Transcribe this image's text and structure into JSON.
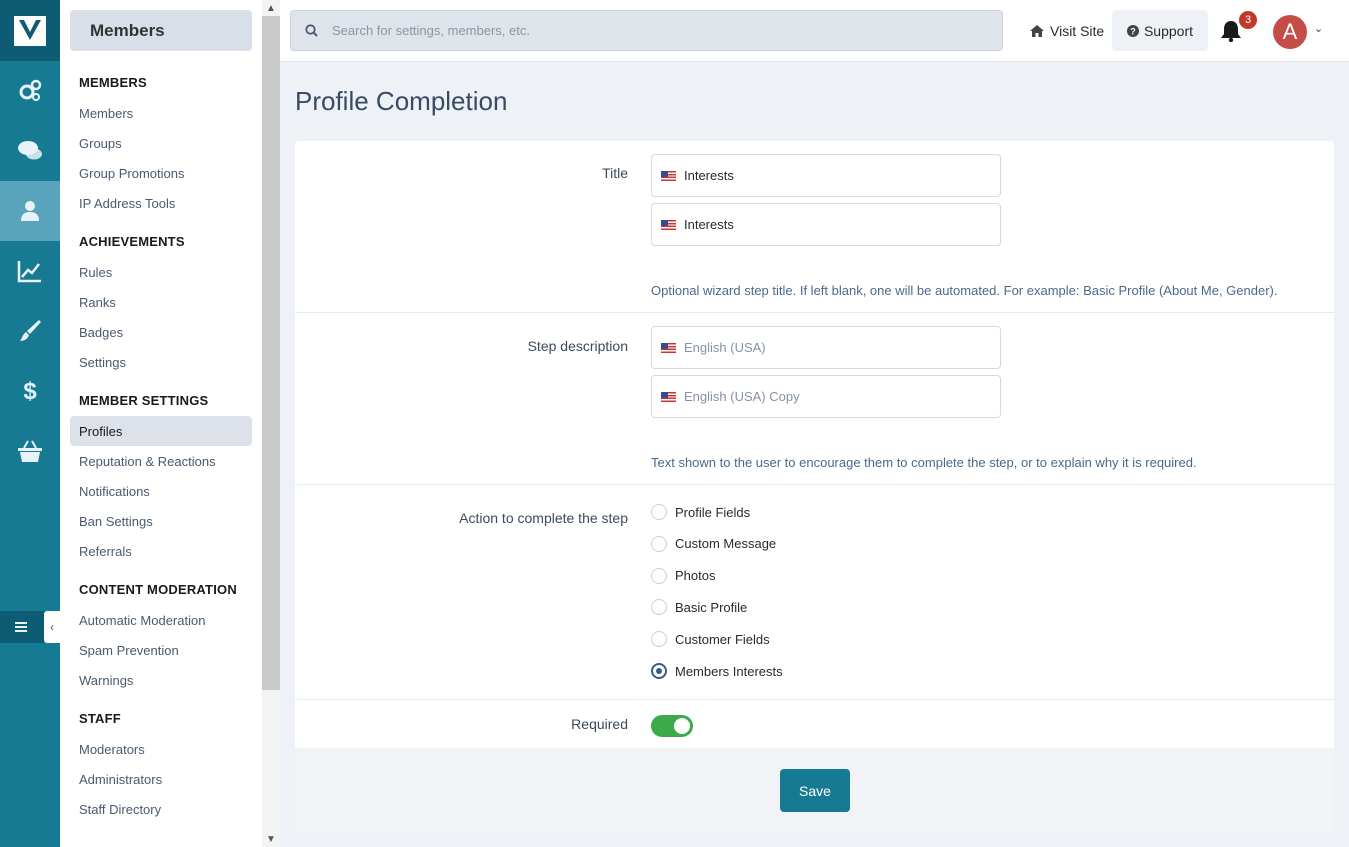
{
  "colors": {
    "rail": "#177a93",
    "accent": "#177a93",
    "toggle_on": "#3daa4a",
    "badge": "#c0392b",
    "avatar": "#c44e47"
  },
  "rail": {
    "icons": [
      "logo-icon",
      "gears-icon",
      "chat-icon",
      "user-icon",
      "chart-icon",
      "brush-icon",
      "dollar-icon",
      "basket-icon",
      "menu-icon",
      "chevron-left-icon"
    ],
    "active": "user-icon"
  },
  "sidebar": {
    "title": "Members",
    "sections": [
      {
        "heading": "MEMBERS",
        "items": [
          "Members",
          "Groups",
          "Group Promotions",
          "IP Address Tools"
        ]
      },
      {
        "heading": "ACHIEVEMENTS",
        "items": [
          "Rules",
          "Ranks",
          "Badges",
          "Settings"
        ]
      },
      {
        "heading": "MEMBER SETTINGS",
        "items": [
          "Profiles",
          "Reputation & Reactions",
          "Notifications",
          "Ban Settings",
          "Referrals"
        ]
      },
      {
        "heading": "CONTENT MODERATION",
        "items": [
          "Automatic Moderation",
          "Spam Prevention",
          "Warnings"
        ]
      },
      {
        "heading": "STAFF",
        "items": [
          "Moderators",
          "Administrators",
          "Staff Directory"
        ]
      }
    ],
    "active_item": "Profiles"
  },
  "topbar": {
    "search_placeholder": "Search for settings, members, etc.",
    "visit_site": "Visit Site",
    "support": "Support",
    "notification_count": "3",
    "avatar_letter": "A"
  },
  "page": {
    "title": "Profile Completion"
  },
  "form": {
    "title": {
      "label": "Title",
      "values": [
        "Interests",
        "Interests"
      ],
      "help": "Optional wizard step title. If left blank, one will be automated. For example: Basic Profile (About Me, Gender)."
    },
    "description": {
      "label": "Step description",
      "placeholders": [
        "English (USA)",
        "English (USA) Copy"
      ],
      "help": "Text shown to the user to encourage them to complete the step, or to explain why it is required."
    },
    "action": {
      "label": "Action to complete the step",
      "options": [
        "Profile Fields",
        "Custom Message",
        "Photos",
        "Basic Profile",
        "Customer Fields",
        "Members Interests"
      ],
      "selected": "Members Interests"
    },
    "required": {
      "label": "Required",
      "on": true
    },
    "save_label": "Save"
  }
}
